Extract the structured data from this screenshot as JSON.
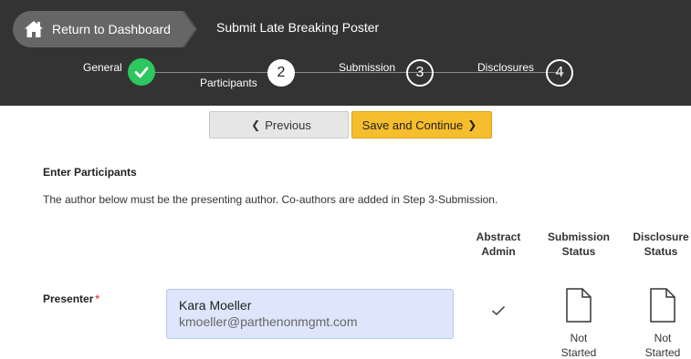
{
  "header": {
    "return_label": "Return to Dashboard",
    "current_page": "Submit Late Breaking Poster"
  },
  "steps": [
    {
      "label": "General",
      "state": "complete"
    },
    {
      "label": "Participants",
      "number": "2",
      "state": "current"
    },
    {
      "label": "Submission",
      "number": "3",
      "state": "todo"
    },
    {
      "label": "Disclosures",
      "number": "4",
      "state": "todo"
    }
  ],
  "actions": {
    "previous_label": "Previous",
    "save_label": "Save and Continue"
  },
  "section": {
    "title": "Enter Participants",
    "instructions": "The author below must be the presenting author. Co-authors are added in Step 3-Submission."
  },
  "columns": {
    "abstract_admin": [
      "Abstract",
      "Admin"
    ],
    "submission_status": [
      "Submission",
      "Status"
    ],
    "disclosure_status": [
      "Disclosure",
      "Status"
    ]
  },
  "presenter": {
    "label": "Presenter",
    "required_mark": "*",
    "name": "Kara Moeller",
    "email": "kmoeller@parthenonmgmt.com",
    "abstract_admin": true,
    "submission_status": [
      "Not",
      "Started"
    ],
    "disclosure_status": [
      "Not",
      "Started"
    ]
  },
  "colors": {
    "topbar": "#333333",
    "crumb": "#666666",
    "complete": "#2ec65e",
    "save_button": "#f6be2c",
    "participant_box": "#dde6fb",
    "required": "#e05050"
  },
  "icons": {
    "home": "home-icon",
    "step_complete": "checkmark-icon",
    "previous": "chevron-left-icon",
    "save": "chevron-right-icon",
    "admin": "checkmark-icon",
    "status": "document-icon"
  }
}
